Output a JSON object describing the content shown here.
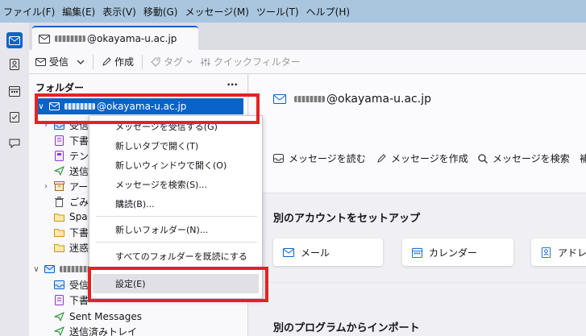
{
  "menubar": [
    "ファイル(F)",
    "編集(E)",
    "表示(V)",
    "移動(G)",
    "メッセージ(M)",
    "ツール(T)",
    "ヘルプ(H)"
  ],
  "tab": {
    "title": "@okayama-u.ac.jp"
  },
  "toolbar": {
    "get": "受信",
    "compose": "作成",
    "tag": "タグ",
    "quickfilter": "クイックフィルター"
  },
  "folderpane": {
    "title": "フォルダー",
    "more": "···",
    "account": "@okayama-u.ac.jp",
    "folders": [
      "受信",
      "下書",
      "テン",
      "送信",
      "アー",
      "ごみ",
      "Spa",
      "下書",
      "迷惑"
    ],
    "account2_folders": [
      "受信",
      "下書",
      "Sent Messages",
      "送信済みトレイ"
    ]
  },
  "main": {
    "account": "@okayama-u.ac.jp",
    "actions": [
      "メッセージを読む",
      "メッセージを作成",
      "メッセージを検索",
      "補"
    ],
    "setup_title": "別のアカウントをセットアップ",
    "cards": [
      "メール",
      "カレンダー",
      "アドレ"
    ],
    "import_title": "別のプログラムからインポート"
  },
  "context_menu": {
    "items": [
      "メッセージを受信する(G)",
      "新しいタブで開く(T)",
      "新しいウィンドウで開く(O)",
      "メッセージを検索(S)...",
      "購読(B)...",
      "新しいフォルダー(N)...",
      "すべてのフォルダーを既読にする",
      "設定(E)"
    ]
  },
  "colors": {
    "accent": "#0a63c8",
    "highlight": "#e52222",
    "menubar": "#a9c6de"
  }
}
